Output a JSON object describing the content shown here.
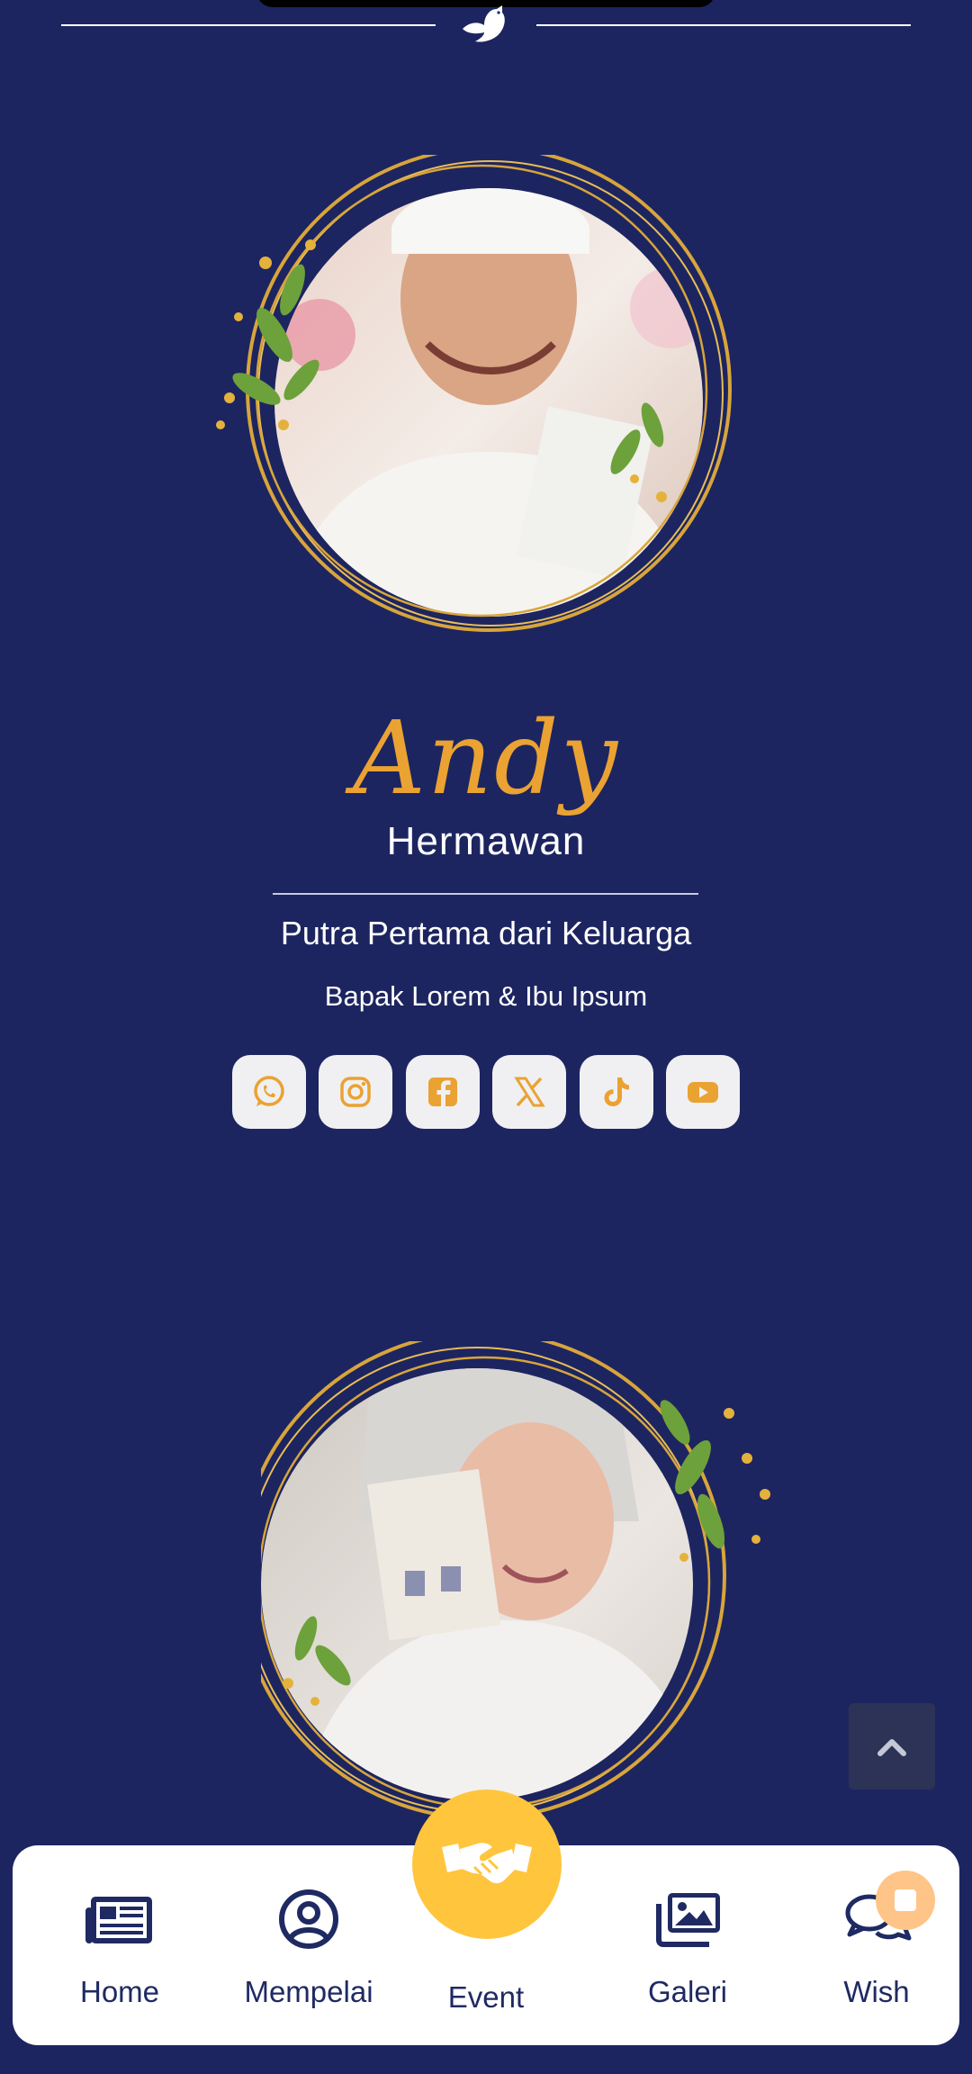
{
  "groom": {
    "nickname": "Andy",
    "surname": "Hermawan",
    "relation": "Putra Pertama dari Keluarga",
    "parents": "Bapak Lorem & Ibu Ipsum",
    "photo_alt": "groom-portrait"
  },
  "bride": {
    "photo_alt": "bride-portrait"
  },
  "social": [
    {
      "icon": "whatsapp-icon"
    },
    {
      "icon": "instagram-icon"
    },
    {
      "icon": "facebook-icon"
    },
    {
      "icon": "x-icon"
    },
    {
      "icon": "tiktok-icon"
    },
    {
      "icon": "youtube-icon"
    }
  ],
  "nav": {
    "home": "Home",
    "mempelai": "Mempelai",
    "event": "Event",
    "galeri": "Galeri",
    "wish": "Wish"
  },
  "colors": {
    "background": "#1d2560",
    "accent_gold": "#eaa232",
    "nav_text": "#1f2a63",
    "event_button": "#ffc53d"
  }
}
